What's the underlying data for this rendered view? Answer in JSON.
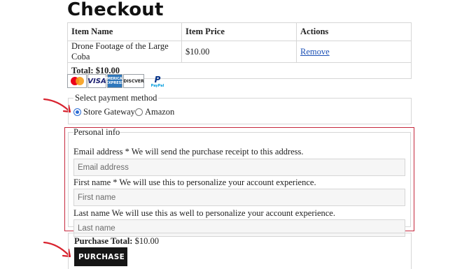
{
  "page": {
    "title": "Checkout"
  },
  "cart": {
    "headers": {
      "name": "Item Name",
      "price": "Item Price",
      "actions": "Actions"
    },
    "items": [
      {
        "name": "Drone Footage of the Large Coba",
        "price": "$10.00",
        "action": "Remove"
      }
    ],
    "total": "Total: $10.00"
  },
  "payment_logos": [
    "mastercard-logo",
    "visa-logo",
    "amex-logo",
    "discover-logo",
    "paypal-logo"
  ],
  "payment": {
    "legend": "Select payment method",
    "options": [
      {
        "label": "Store Gateway",
        "selected": true
      },
      {
        "label": "Amazon",
        "selected": false
      }
    ]
  },
  "personal": {
    "legend": "Personal info",
    "email": {
      "label": "Email address * We will send the purchase receipt to this address.",
      "placeholder": "Email address"
    },
    "first_name": {
      "label": "First name * We will use this to personalize your account experience.",
      "placeholder": "First name"
    },
    "last_name": {
      "label": "Last name We will use this as well to personalize your account experience.",
      "placeholder": "Last name"
    }
  },
  "purchase": {
    "total_label": "Purchase Total:",
    "total_value": "$10.00",
    "button": "PURCHASE"
  },
  "colors": {
    "highlight": "#c5283d",
    "button_bg": "#161616",
    "link": "#1a4fb5",
    "radio_accent": "#2b6cd4"
  }
}
